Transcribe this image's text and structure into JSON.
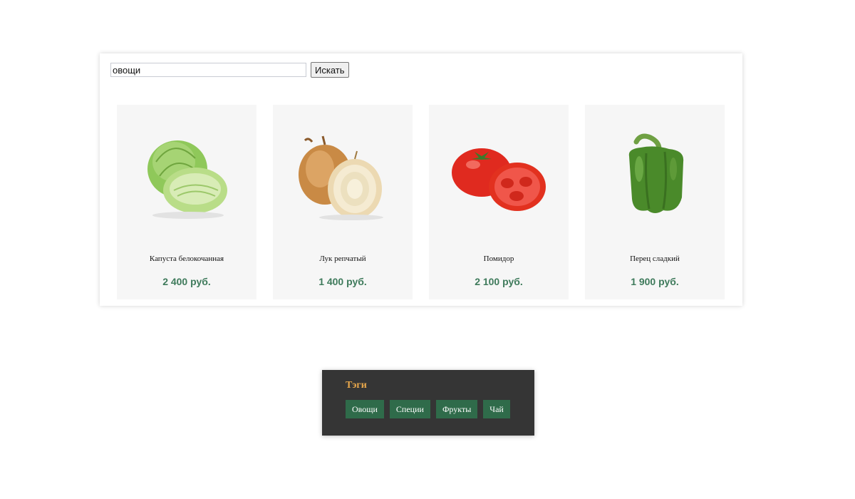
{
  "search": {
    "value": "овощи",
    "button_label": "Искать"
  },
  "products": [
    {
      "name": "Капуста белокочанная",
      "price": "2 400 руб.",
      "image_icon": "cabbage-icon"
    },
    {
      "name": "Лук репчатый",
      "price": "1 400 руб.",
      "image_icon": "onion-icon"
    },
    {
      "name": "Помидор",
      "price": "2 100 руб.",
      "image_icon": "tomato-icon"
    },
    {
      "name": "Перец сладкий",
      "price": "1 900 руб.",
      "image_icon": "pepper-icon"
    }
  ],
  "tags": {
    "title": "Тэги",
    "items": [
      "Овощи",
      "Специи",
      "Фрукты",
      "Чай"
    ]
  },
  "colors": {
    "price": "#3e7a5b",
    "tag_bg": "#2f6b4a",
    "tags_panel_bg": "#353535",
    "tags_title": "#e9a84b"
  }
}
